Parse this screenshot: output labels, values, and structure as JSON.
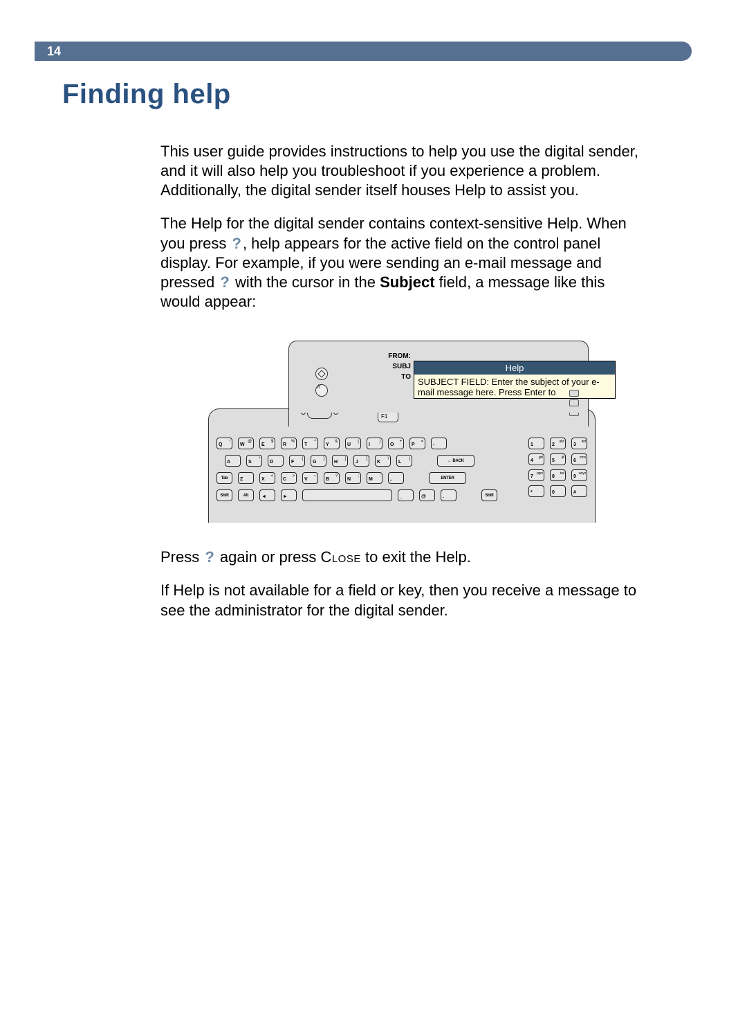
{
  "page_number": "14",
  "title": "Finding help",
  "paragraphs": {
    "p1": "This user guide provides instructions to help you use the digital sender, and it will also help you troubleshoot if you experience a problem. Additionally, the digital sender itself houses Help to assist you.",
    "p2_a": "The Help for the digital sender contains context-sensitive Help. When you press ",
    "p2_b": ", help appears for the active field on the control panel display. For example, if you were sending an e-mail message and pressed ",
    "p2_c": " with the cursor in the ",
    "p2_subject": "Subject",
    "p2_d": " field, a message like this would appear:",
    "p3_a": "Press ",
    "p3_b": " again or press ",
    "p3_close": "Close",
    "p3_c": " to exit the Help.",
    "p4": "If Help is not available for a field or key, then you receive a message to see the administrator for the digital sender."
  },
  "qmark": "?",
  "figure": {
    "labels": {
      "from": "FROM:",
      "subj": "SUBJ",
      "to": "TO"
    },
    "help_title": "Help",
    "help_body": "SUBJECT FIELD:  Enter the subject of your e-mail message here. Press Enter to",
    "f1": "F1",
    "keys": {
      "row1": [
        {
          "m": "Q",
          "s": "!"
        },
        {
          "m": "W",
          "s": "@"
        },
        {
          "m": "E",
          "s": "$"
        },
        {
          "m": "R",
          "s": "%"
        },
        {
          "m": "T",
          "s": "^"
        },
        {
          "m": "Y",
          "s": "&"
        },
        {
          "m": "U",
          "s": "("
        },
        {
          "m": "I",
          "s": ")"
        },
        {
          "m": "O",
          "s": "+"
        },
        {
          "m": "P",
          "s": "="
        },
        {
          "m": "-",
          "s": ""
        }
      ],
      "row2": [
        {
          "m": "A",
          "s": ""
        },
        {
          "m": "S",
          "s": "*"
        },
        {
          "m": "D",
          "s": ""
        },
        {
          "m": "F",
          "s": "{"
        },
        {
          "m": "G",
          "s": "}"
        },
        {
          "m": "H",
          "s": "["
        },
        {
          "m": "J",
          "s": "]"
        },
        {
          "m": "K",
          "s": "\\"
        },
        {
          "m": "L",
          "s": "|"
        }
      ],
      "row3": [
        {
          "m": "Z",
          "s": ""
        },
        {
          "m": "X",
          "s": "<"
        },
        {
          "m": "C",
          "s": ">"
        },
        {
          "m": "V",
          "s": "~"
        },
        {
          "m": "B",
          "s": "?"
        },
        {
          "m": "N",
          "s": ";"
        },
        {
          "m": "M",
          "s": ":"
        },
        {
          "m": ",",
          "s": ""
        }
      ],
      "tab": "Tab",
      "alt": "Alt",
      "shift": "Shift",
      "back": "← BACK",
      "enter": "ENTER",
      "at": "@",
      "dot": "."
    },
    "numpad": [
      {
        "m": "1",
        "s": ""
      },
      {
        "m": "2",
        "s": "abc"
      },
      {
        "m": "3",
        "s": "def"
      },
      {
        "m": "4",
        "s": "ghi"
      },
      {
        "m": "5",
        "s": "jkl"
      },
      {
        "m": "6",
        "s": "mno"
      },
      {
        "m": "7",
        "s": "pqrs"
      },
      {
        "m": "8",
        "s": "tuv"
      },
      {
        "m": "9",
        "s": "wxyz"
      },
      {
        "m": "*",
        "s": ""
      },
      {
        "m": "0",
        "s": ""
      },
      {
        "m": "#",
        "s": ""
      }
    ]
  }
}
